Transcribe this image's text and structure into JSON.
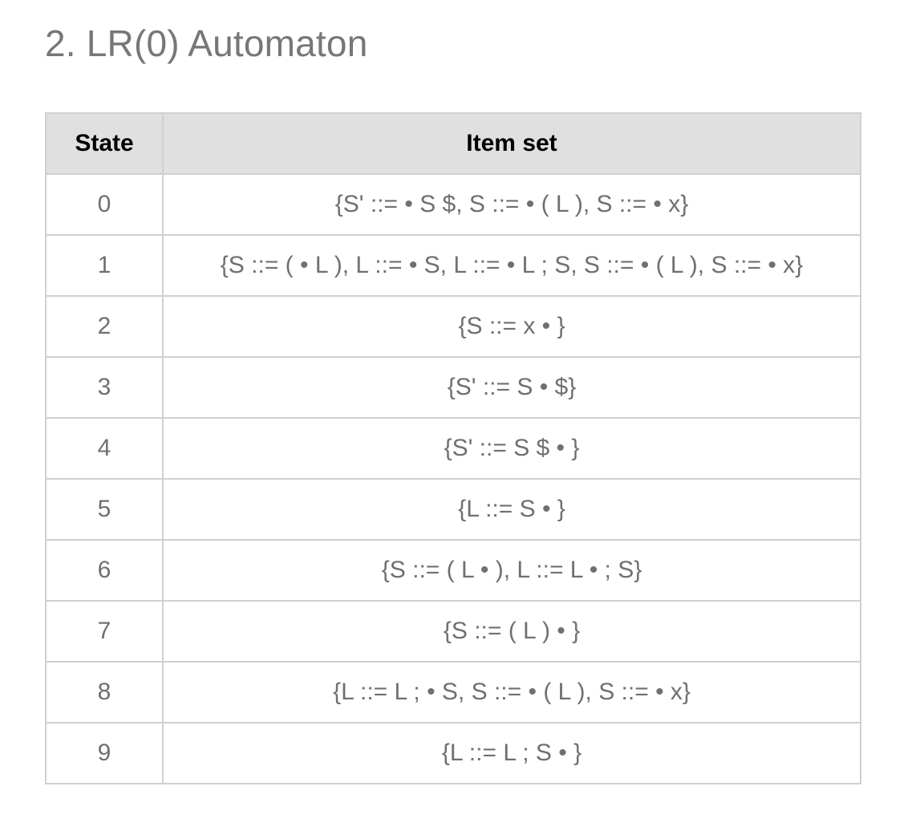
{
  "heading": "2. LR(0) Automaton",
  "table": {
    "headers": {
      "state": "State",
      "item_set": "Item set"
    },
    "rows": [
      {
        "state": "0",
        "item_set": "{S' ::= • S $, S ::= • ( L ), S ::= • x}"
      },
      {
        "state": "1",
        "item_set": "{S ::= ( • L ), L ::= • S, L ::= • L ; S, S ::= • ( L ), S ::= • x}"
      },
      {
        "state": "2",
        "item_set": "{S ::= x • }"
      },
      {
        "state": "3",
        "item_set": "{S' ::= S • $}"
      },
      {
        "state": "4",
        "item_set": "{S' ::= S $ • }"
      },
      {
        "state": "5",
        "item_set": "{L ::= S • }"
      },
      {
        "state": "6",
        "item_set": "{S ::= ( L • ), L ::= L • ; S}"
      },
      {
        "state": "7",
        "item_set": "{S ::= ( L ) • }"
      },
      {
        "state": "8",
        "item_set": "{L ::= L ; • S, S ::= • ( L ), S ::= • x}"
      },
      {
        "state": "9",
        "item_set": "{L ::= L ; S • }"
      }
    ]
  },
  "colors": {
    "heading": "#777777",
    "header_bg": "#e0e0e0",
    "border": "#d0d0d0",
    "cell_text": "#707070"
  }
}
